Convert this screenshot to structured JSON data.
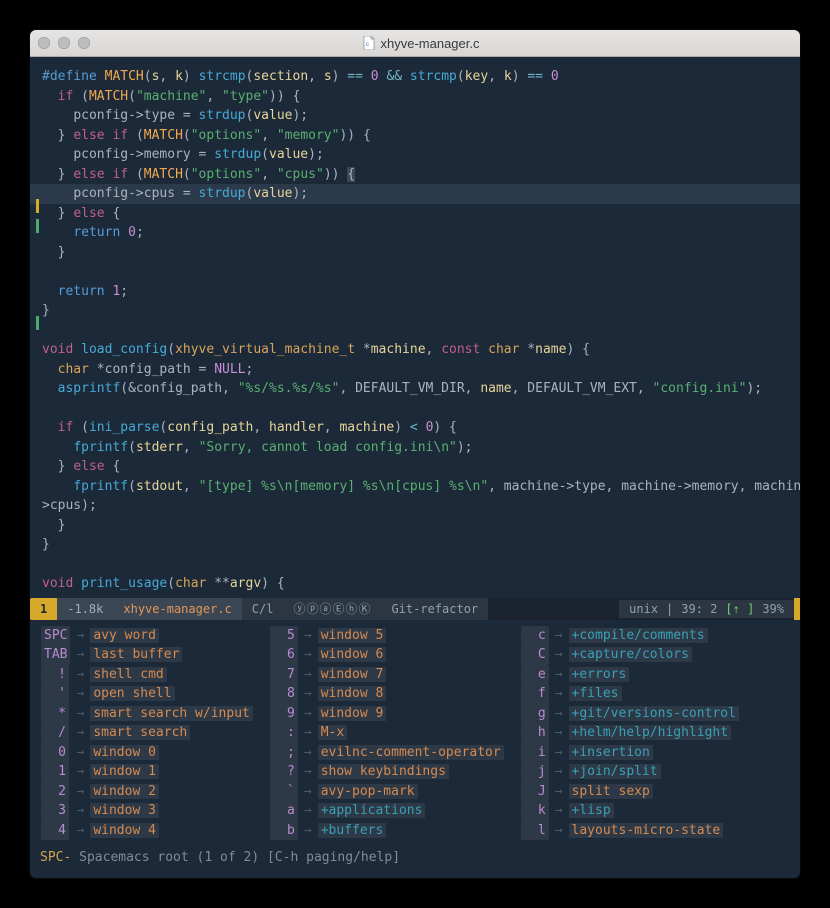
{
  "titlebar": {
    "filename": "xhyve-manager.c"
  },
  "code": {
    "l1_define": "#define",
    "l1_match": "MATCH",
    "l1_args": "(s, k)",
    "l1_strcmp1": "strcmp",
    "l1_sec": "section",
    "l1_s": "s",
    "l1_eq1": "==",
    "l1_z1": "0",
    "l1_and": "&&",
    "l1_strcmp2": "strcmp",
    "l1_key": "key",
    "l1_k": "k",
    "l1_eq2": "==",
    "l1_z2": "0",
    "l2_if": "if",
    "l2_match": "MATCH",
    "l2_s1": "\"machine\"",
    "l2_s2": "\"type\"",
    "l3_txt": "pconfig->type = ",
    "l3_fn": "strdup",
    "l3_arg": "value",
    "l4_else": "else",
    "l4_if": "if",
    "l4_match": "MATCH",
    "l4_s1": "\"options\"",
    "l4_s2": "\"memory\"",
    "l5_txt": "pconfig->memory = ",
    "l5_fn": "strdup",
    "l5_arg": "value",
    "l6_else": "else",
    "l6_if": "if",
    "l6_match": "MATCH",
    "l6_s1": "\"options\"",
    "l6_s2": "\"cpus\"",
    "l7_txt": "pconfig->cpus = ",
    "l7_fn": "strdup",
    "l7_arg": "value",
    "l8_else": "else",
    "l9_return": "return",
    "l9_val": "0",
    "l11_return": "return",
    "l11_val": "1",
    "l14_void": "void",
    "l14_fn": "load_config",
    "l14_ty": "xhyve_virtual_machine_t",
    "l14_p1": "machine",
    "l14_const": "const",
    "l14_char": "char",
    "l14_p2": "name",
    "l15_char": "char",
    "l15_txt": "*config_path = ",
    "l15_null": "NULL",
    "l16_fn": "asprintf",
    "l16_s1": "\"%s/%s.%s/%s\"",
    "l16_a1": "DEFAULT_VM_DIR",
    "l16_a2": "name",
    "l16_a3": "DEFAULT_VM_EXT",
    "l16_s2": "\"config.ini\"",
    "l18_if": "if",
    "l18_fn": "ini_parse",
    "l18_a1": "config_path",
    "l18_a2": "handler",
    "l18_a3": "machine",
    "l18_op": "<",
    "l18_z": "0",
    "l19_fn": "fprintf",
    "l19_a1": "stderr",
    "l19_s": "\"Sorry, cannot load config.ini\\n\"",
    "l20_else": "else",
    "l21_fn": "fprintf",
    "l21_a1": "stdout",
    "l21_s": "\"[type] %s\\n[memory] %s\\n[cpus] %s\\n\"",
    "l21_tail": ", machine->type, machine->memory, machine-",
    "l22_txt": ">cpus);",
    "l26_void": "void",
    "l26_fn": "print_usage",
    "l26_char": "char",
    "l26_arg": "argv"
  },
  "modeline": {
    "win_num": "1",
    "size": "1.8k",
    "filename": "xhyve-manager.c",
    "mode": "C/l",
    "indicators": "ⓨⓟⓐⒺⓗⓀ",
    "branch": "Git-refactor",
    "encoding": "unix",
    "pos": "39: 2",
    "arrows": "[⇡ ]",
    "pct": "39%"
  },
  "which_key": {
    "rows": [
      [
        "SPC",
        "avy word",
        "5",
        "window 5",
        "c",
        "+compile/comments"
      ],
      [
        "TAB",
        "last buffer",
        "6",
        "window 6",
        "C",
        "+capture/colors"
      ],
      [
        "!",
        "shell cmd",
        "7",
        "window 7",
        "e",
        "+errors"
      ],
      [
        "'",
        "open shell",
        "8",
        "window 8",
        "f",
        "+files"
      ],
      [
        "*",
        "smart search w/input",
        "9",
        "window 9",
        "g",
        "+git/versions-control"
      ],
      [
        "/",
        "smart search",
        ":",
        "M-x",
        "h",
        "+helm/help/highlight"
      ],
      [
        "0",
        "window 0",
        ";",
        "evilnc-comment-operator",
        "i",
        "+insertion"
      ],
      [
        "1",
        "window 1",
        "?",
        "show keybindings",
        "j",
        "+join/split"
      ],
      [
        "2",
        "window 2",
        "`",
        "avy-pop-mark",
        "J",
        "split sexp"
      ],
      [
        "3",
        "window 3",
        "a",
        "+applications",
        "k",
        "+lisp"
      ],
      [
        "4",
        "window 4",
        "b",
        "+buffers",
        "l",
        "layouts-micro-state"
      ]
    ]
  },
  "echo": {
    "prefix": "SPC-",
    "text": " Spacemacs root (1 of 2) [C-h paging/help]"
  }
}
